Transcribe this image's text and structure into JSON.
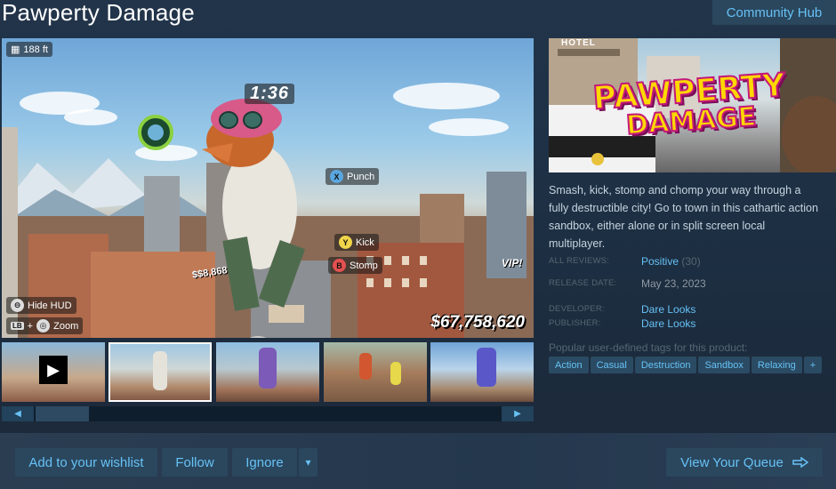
{
  "title": "Pawperty Damage",
  "community_hub": "Community Hub",
  "media": {
    "altitude": "188 ft",
    "timer": "1:36",
    "prompts": {
      "punch": {
        "button": "X",
        "label": "Punch"
      },
      "kick": {
        "button": "Y",
        "label": "Kick"
      },
      "stomp": {
        "button": "B",
        "label": "Stomp"
      }
    },
    "hide_hud": "Hide HUD",
    "zoom": {
      "lb": "LB",
      "plus": "+",
      "label": "Zoom"
    },
    "money": "$67,758,620",
    "vip": "VIP!",
    "crash_text": "$$8,868"
  },
  "capsule": {
    "hotel_sign": "HOTEL",
    "logo_line1": "PAWPERTY",
    "logo_line2": "DAMAGE"
  },
  "description": "Smash, kick, stomp and chomp your way through a fully destructible city! Go to town in this cathartic action sandbox, either alone or in split screen local multiplayer.",
  "info": {
    "reviews_label": "ALL REVIEWS:",
    "reviews_value": "Positive",
    "reviews_count": "(30)",
    "release_label": "RELEASE DATE:",
    "release_value": "May 23, 2023",
    "developer_label": "DEVELOPER:",
    "developer_value": "Dare Looks",
    "publisher_label": "PUBLISHER:",
    "publisher_value": "Dare Looks"
  },
  "tags_title": "Popular user-defined tags for this product:",
  "tags": [
    "Action",
    "Casual",
    "Destruction",
    "Sandbox",
    "Relaxing",
    "+"
  ],
  "scroll": {
    "left": "◀",
    "right": "▶"
  },
  "actions": {
    "wishlist": "Add to your wishlist",
    "follow": "Follow",
    "ignore": "Ignore",
    "ignore_dropdown": "▾",
    "queue": "View Your Queue"
  },
  "colors": {
    "background": "#1b2838",
    "accent": "#67c1f5",
    "button_bg": "#2a475e",
    "label": "#556772",
    "text": "#c6d4df"
  }
}
